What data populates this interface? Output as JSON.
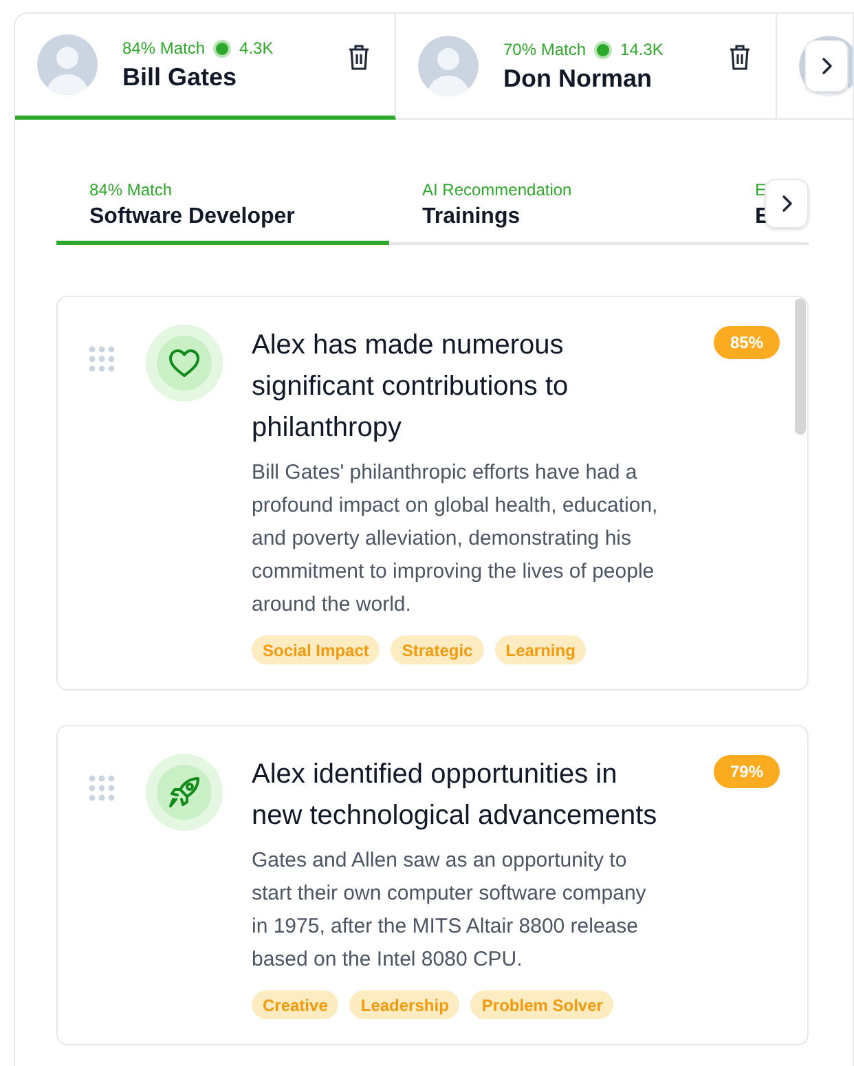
{
  "profiles": [
    {
      "match": "84% Match",
      "followers": "4.3K",
      "name": "Bill Gates",
      "selected": true
    },
    {
      "match": "70% Match",
      "followers": "14.3K",
      "name": "Don Norman",
      "selected": false
    }
  ],
  "role_tabs": [
    {
      "caption": "84% Match",
      "label": "Software Developer",
      "selected": true
    },
    {
      "caption": "AI Recommendation",
      "label": "Trainings",
      "selected": false
    },
    {
      "caption": "E",
      "label": "E",
      "selected": false
    }
  ],
  "cards": [
    {
      "kind": "heart",
      "title": "Alex has made numerous significant contributions to philanthropy",
      "score": "85%",
      "description": "Bill Gates' philanthropic efforts have had a profound impact on global health, education, and poverty alleviation, demonstrating his commitment to improving the lives of people around the world.",
      "tags": [
        "Social Impact",
        "Strategic",
        "Learning"
      ]
    },
    {
      "kind": "rocket",
      "title": "Alex identified opportunities in new technological advancements",
      "score": "79%",
      "description": "Gates and Allen saw as an opportunity to start their own computer software company in 1975, after the MITS Altair 8800 release based on the Intel 8080 CPU.",
      "tags": [
        "Creative",
        "Leadership",
        "Problem Solver"
      ]
    }
  ]
}
